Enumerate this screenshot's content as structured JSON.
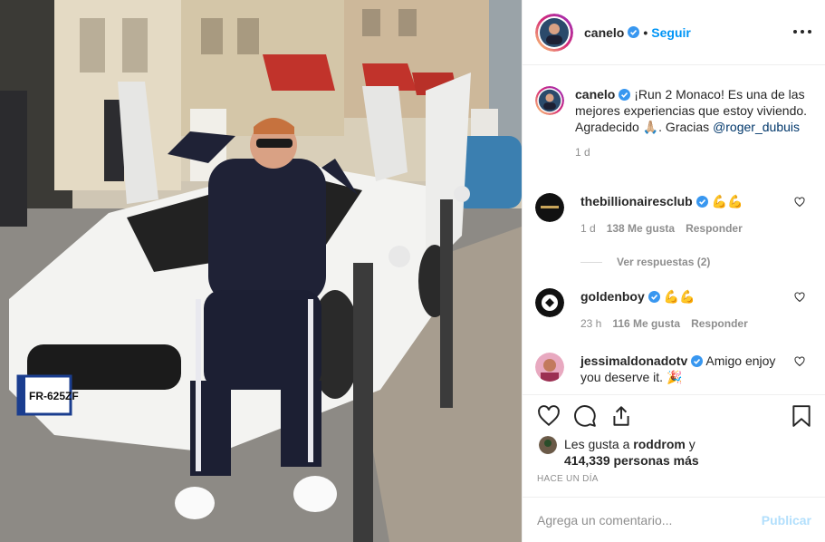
{
  "header": {
    "username": "canelo",
    "separator": "•",
    "follow_label": "Seguir"
  },
  "caption": {
    "username": "canelo",
    "text": "¡Run 2 Monaco! Es una de las mejores experiencias que estoy viviendo. Agradecido 🙏🏼. Gracias",
    "mention": "@roger_dubuis",
    "time": "1 d"
  },
  "comments": [
    {
      "username": "thebillionairesclub",
      "text": "💪💪",
      "time": "1 d",
      "likes": "138 Me gusta",
      "reply": "Responder"
    },
    {
      "username": "goldenboy",
      "text": "💪💪",
      "time": "23 h",
      "likes": "116 Me gusta",
      "reply": "Responder"
    },
    {
      "username": "jessimaldonadotv",
      "text": "Amigo enjoy you deserve it. 🎉",
      "time": "",
      "likes": "",
      "reply": ""
    }
  ],
  "view_replies": "Ver respuestas (2)",
  "likes": {
    "prefix": "Les gusta a",
    "user": "roddrom",
    "conj": "y",
    "count": "414,339 personas más"
  },
  "posted": "Hace un día",
  "comment_box": {
    "placeholder": "Agrega un comentario...",
    "publish_label": "Publicar"
  },
  "photo": {
    "plate": "FR-625ZF"
  },
  "colors": {
    "link": "#0095f6",
    "publish_disabled": "#b2dffc",
    "secondary_text": "#8e8e8e"
  }
}
